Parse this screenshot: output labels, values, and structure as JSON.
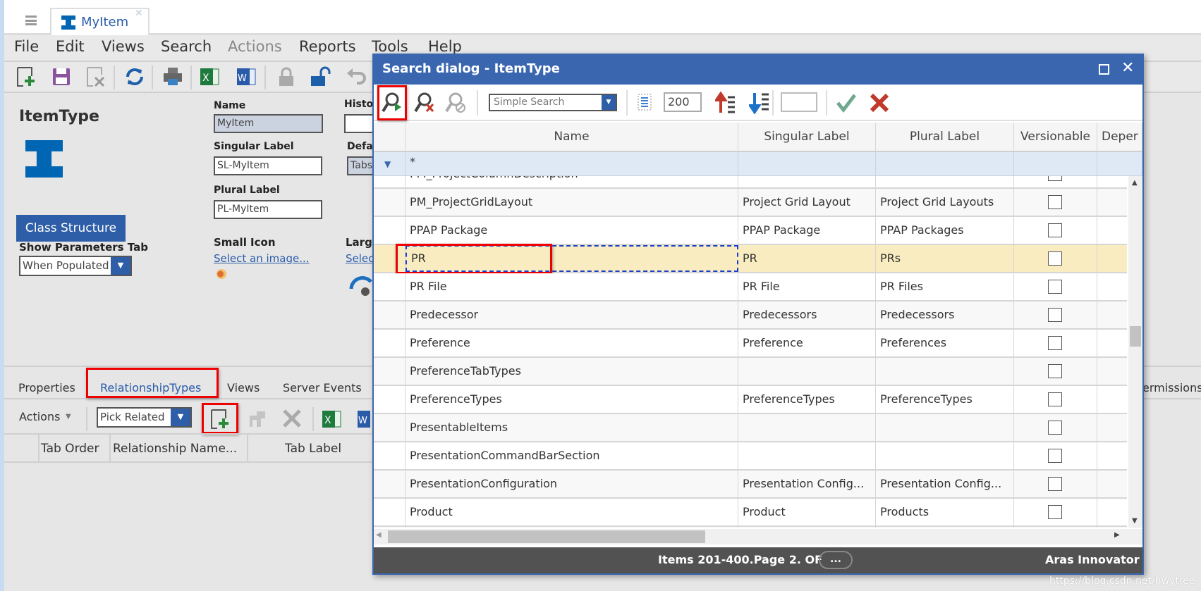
{
  "app": {
    "tab_label": "MyItem",
    "menu": [
      "File",
      "Edit",
      "Views",
      "Search",
      "Actions",
      "Reports",
      "Tools",
      "Help"
    ],
    "menu_disabled": [
      "Actions"
    ]
  },
  "form": {
    "title": "ItemType",
    "name_label": "Name",
    "name_value": "MyItem",
    "singular_label": "Singular Label",
    "singular_value": "SL-MyItem",
    "plural_label": "Plural Label",
    "plural_value": "PL-MyItem",
    "history_label": "Histo",
    "default_label": "Defa",
    "default_value": "Tabs",
    "class_structure_button": "Class Structure",
    "show_params_label": "Show Parameters Tab",
    "show_params_value": "When Populated",
    "small_icon_label": "Small Icon",
    "small_icon_link": "Select an image...",
    "large_icon_label": "Larg",
    "large_icon_link": "Selec"
  },
  "relationships": {
    "tabs": [
      "Properties",
      "RelationshipTypes",
      "Views",
      "Server Events"
    ],
    "tab_right": "ermissions",
    "active_tab": "RelationshipTypes",
    "actions_label": "Actions",
    "pick_mode": "Pick Related",
    "columns": [
      "Tab Order",
      "Relationship Name...",
      "Tab Label"
    ]
  },
  "dialog": {
    "title": "Search dialog - ItemType",
    "search_mode": "Simple Search",
    "page_size": "200",
    "columns": [
      "Name",
      "Singular Label",
      "Plural Label",
      "Versionable",
      "Deper"
    ],
    "filter_name": "*",
    "rows": [
      {
        "name": "PM_ProjectColumnDescription",
        "singular": "",
        "plural": "",
        "selected": false
      },
      {
        "name": "PM_ProjectGridLayout",
        "singular": "Project Grid Layout",
        "plural": "Project Grid Layouts",
        "selected": false
      },
      {
        "name": "PPAP Package",
        "singular": "PPAP Package",
        "plural": "PPAP Packages",
        "selected": false
      },
      {
        "name": "PR",
        "singular": "PR",
        "plural": "PRs",
        "selected": true
      },
      {
        "name": "PR File",
        "singular": "PR File",
        "plural": "PR Files",
        "selected": false
      },
      {
        "name": "Predecessor",
        "singular": "Predecessors",
        "plural": "Predecessors",
        "selected": false
      },
      {
        "name": "Preference",
        "singular": "Preference",
        "plural": "Preferences",
        "selected": false
      },
      {
        "name": "PreferenceTabTypes",
        "singular": "",
        "plural": "",
        "selected": false
      },
      {
        "name": "PreferenceTypes",
        "singular": "PreferenceTypes",
        "plural": "PreferenceTypes",
        "selected": false
      },
      {
        "name": "PresentableItems",
        "singular": "",
        "plural": "",
        "selected": false
      },
      {
        "name": "PresentationCommandBarSection",
        "singular": "",
        "plural": "",
        "selected": false
      },
      {
        "name": "PresentationConfiguration",
        "singular": "Presentation Config...",
        "plural": "Presentation Config...",
        "selected": false
      },
      {
        "name": "Product",
        "singular": "Product",
        "plural": "Products",
        "selected": false
      },
      {
        "name": "",
        "singular": "",
        "plural": "",
        "selected": false
      }
    ],
    "footer_text": "Items 201-400.Page 2. OF",
    "footer_more": "...",
    "brand": "Aras Innovator"
  },
  "watermark": "https://blog.csdn.net/hwytree",
  "colors": {
    "accent": "#3a66b0",
    "selected_row": "#f8ecc0",
    "highlight_box": "#ee0000",
    "filter_row": "#dfe8f5"
  }
}
